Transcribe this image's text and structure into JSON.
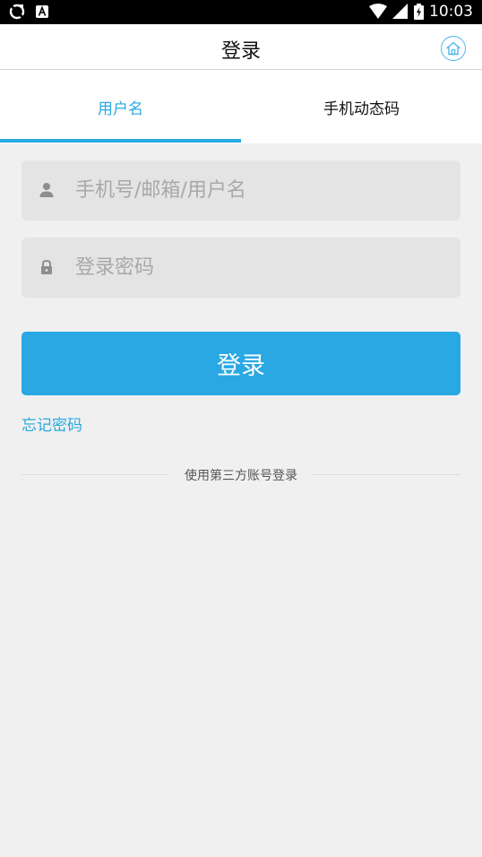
{
  "status_bar": {
    "time": "10:03",
    "icons": [
      "sync-icon",
      "a-badge-icon",
      "wifi-icon",
      "signal-icon",
      "battery-charging-icon"
    ]
  },
  "app_bar": {
    "title": "登录",
    "home_icon": "home-icon"
  },
  "tabs": [
    {
      "label": "用户名",
      "active": true
    },
    {
      "label": "手机动态码",
      "active": false
    }
  ],
  "form": {
    "username": {
      "placeholder": "手机号/邮箱/用户名",
      "value": "",
      "icon": "user-icon"
    },
    "password": {
      "placeholder": "登录密码",
      "value": "",
      "icon": "lock-icon"
    },
    "submit_label": "登录",
    "forgot_label": "忘记密码",
    "third_party_label": "使用第三方账号登录"
  },
  "colors": {
    "accent": "#29a8e0",
    "background": "#f0f0f0",
    "field_bg": "#e4e4e4"
  }
}
